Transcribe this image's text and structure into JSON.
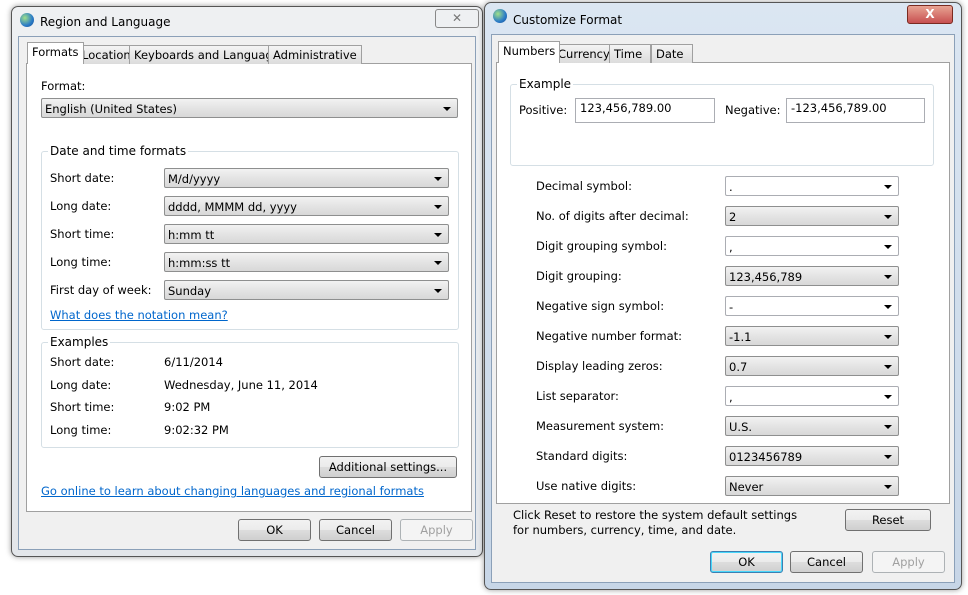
{
  "region": {
    "title": "Region and Language",
    "tabs": [
      "Formats",
      "Location",
      "Keyboards and Languages",
      "Administrative"
    ],
    "format_label": "Format:",
    "format_value": "English (United States)",
    "date_time_group": "Date and time formats",
    "fields": [
      {
        "label": "Short date:",
        "value": "M/d/yyyy"
      },
      {
        "label": "Long date:",
        "value": "dddd, MMMM dd, yyyy"
      },
      {
        "label": "Short time:",
        "value": "h:mm tt"
      },
      {
        "label": "Long time:",
        "value": "h:mm:ss tt"
      },
      {
        "label": "First day of week:",
        "value": "Sunday"
      }
    ],
    "notation_link": "What does the notation mean?",
    "examples_group": "Examples",
    "examples": [
      {
        "label": "Short date:",
        "value": "6/11/2014"
      },
      {
        "label": "Long date:",
        "value": "Wednesday, June 11, 2014"
      },
      {
        "label": "Short time:",
        "value": "9:02 PM"
      },
      {
        "label": "Long time:",
        "value": "9:02:32 PM"
      }
    ],
    "additional_button": "Additional settings...",
    "online_link": "Go online to learn about changing languages and regional formats",
    "ok": "OK",
    "cancel": "Cancel",
    "apply": "Apply"
  },
  "customize": {
    "title": "Customize Format",
    "close": "X",
    "tabs": [
      "Numbers",
      "Currency",
      "Time",
      "Date"
    ],
    "example_group": "Example",
    "positive_label": "Positive:",
    "positive_value": "123,456,789.00",
    "negative_label": "Negative:",
    "negative_value": "-123,456,789.00",
    "settings": [
      {
        "label": "Decimal symbol:",
        "value": "."
      },
      {
        "label": "No. of digits after decimal:",
        "value": "2"
      },
      {
        "label": "Digit grouping symbol:",
        "value": ","
      },
      {
        "label": "Digit grouping:",
        "value": "123,456,789"
      },
      {
        "label": "Negative sign symbol:",
        "value": "-"
      },
      {
        "label": "Negative number format:",
        "value": "-1.1"
      },
      {
        "label": "Display leading zeros:",
        "value": "0.7"
      },
      {
        "label": "List separator:",
        "value": ","
      },
      {
        "label": "Measurement system:",
        "value": "U.S."
      },
      {
        "label": "Standard digits:",
        "value": "0123456789"
      },
      {
        "label": "Use native digits:",
        "value": "Never"
      }
    ],
    "reset_text": "Click Reset to restore the system default settings for numbers, currency, time, and date.",
    "reset": "Reset",
    "ok": "OK",
    "cancel": "Cancel",
    "apply": "Apply"
  }
}
